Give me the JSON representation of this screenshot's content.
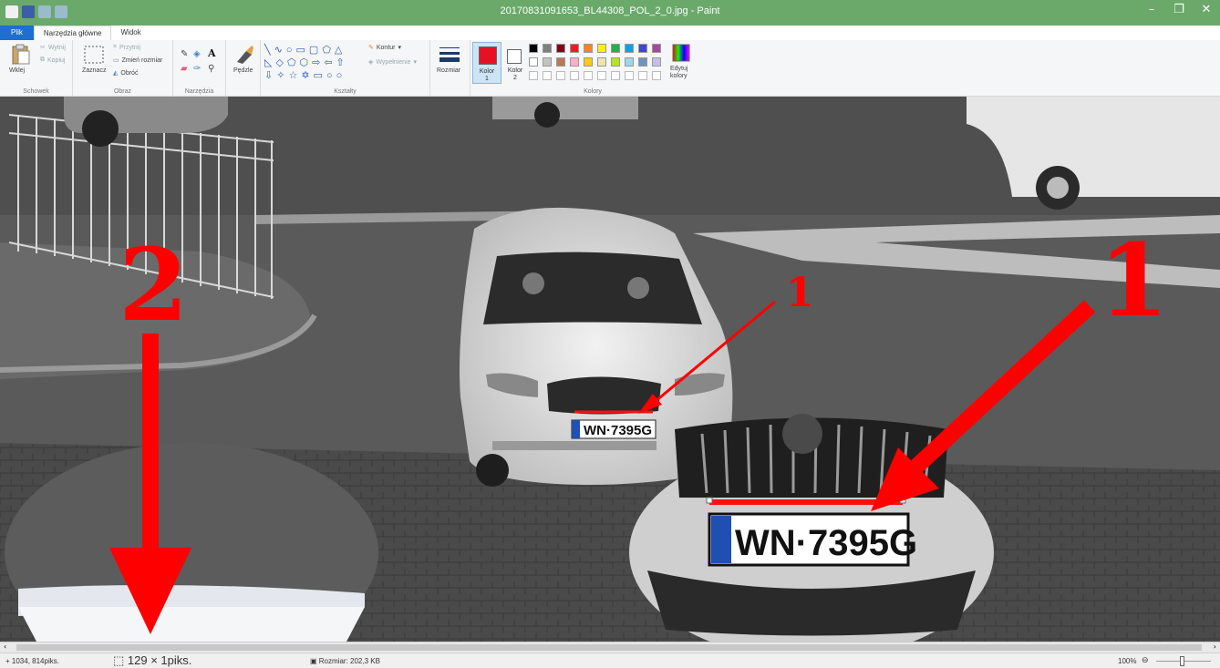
{
  "window": {
    "title": "20170831091653_BL44308_POL_2_0.jpg - Paint",
    "minimize": "–",
    "restore": "❐",
    "close": "✕"
  },
  "tabs": [
    {
      "label": "Plik"
    },
    {
      "label": "Narzędzia główne"
    },
    {
      "label": "Widok"
    }
  ],
  "ribbon": {
    "clipboard": {
      "paste": "Wklej",
      "cut": "Wytnij",
      "copy": "Kopiuj",
      "group": "Schowek"
    },
    "image": {
      "select": "Zaznacz",
      "crop": "Przytnij",
      "resize": "Zmień rozmiar",
      "rotate": "Obróć",
      "group": "Obraz"
    },
    "tools": {
      "group": "Narzędzia",
      "text_tool": "A"
    },
    "brushes": {
      "label": "Pędzle"
    },
    "shapes": {
      "outline": "Kontur",
      "fill": "Wypełnienie",
      "group": "Kształty"
    },
    "size": {
      "label": "Rozmiar"
    },
    "colors": {
      "color1": "Kolor",
      "color1_num": "1",
      "color2": "Kolor",
      "color2_num": "2",
      "edit": "Edytuj",
      "edit2": "kolory",
      "group": "Kolory",
      "active_color": "#e81123",
      "palette_row1": [
        "#000000",
        "#7f7f7f",
        "#880015",
        "#ed1c24",
        "#ff7f27",
        "#fff200",
        "#22b14c",
        "#00a2e8",
        "#3f48cc",
        "#a349a4"
      ],
      "palette_row2": [
        "#ffffff",
        "#c3c3c3",
        "#b97a57",
        "#ffaec9",
        "#ffc90e",
        "#efe4b0",
        "#b5e61d",
        "#99d9ea",
        "#7092be",
        "#c8bfe7"
      ]
    }
  },
  "annotations": {
    "label_1_small": "1",
    "label_1_big": "1",
    "label_2": "2",
    "plate_text": "WN·7395G",
    "plate_text_zoom": "WN·7395G",
    "arrow_color": "#ff0000"
  },
  "status": {
    "cursor_pos": "1034, 814piks.",
    "selection_size": "129 × 1piks.",
    "file_size": "Rozmiar: 202,3 KB",
    "zoom": "100%"
  }
}
